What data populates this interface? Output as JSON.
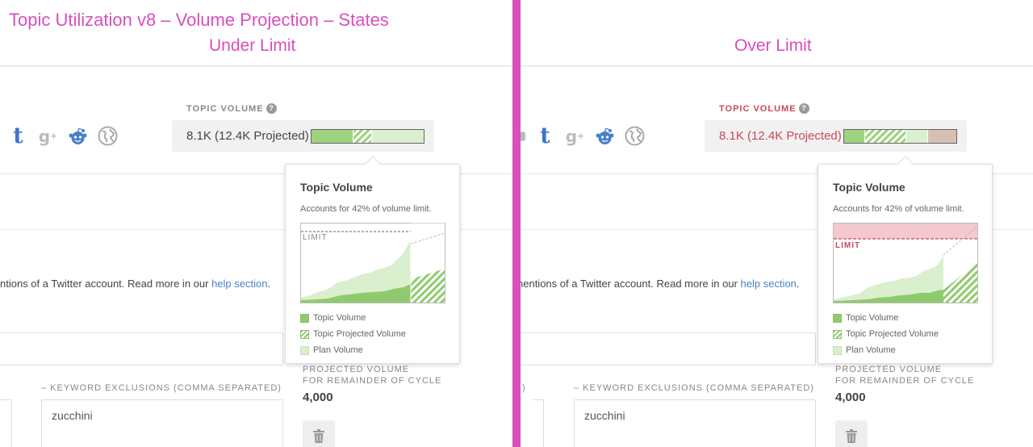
{
  "header": {
    "title": "Topic Utilization v8 – Volume Projection – States"
  },
  "states": {
    "under": {
      "label": "Under Limit",
      "topic_volume_label": "TOPIC VOLUME",
      "topic_volume_value": "8.1K (12.4K Projected)",
      "usage_bar": {
        "volume": 0.37,
        "projected": 0.16,
        "plan": 0.47,
        "over": 0
      },
      "popover": {
        "title": "Topic Volume",
        "subtitle": "Accounts for 42% of volume limit.",
        "limit_label": "LIMIT",
        "legend": [
          "Topic Volume",
          "Topic Projected Volume",
          "Plan Volume"
        ]
      }
    },
    "over": {
      "label": "Over Limit",
      "topic_volume_label": "TOPIC VOLUME",
      "topic_volume_value": "8.1K (12.4K Projected)",
      "usage_bar": {
        "volume": 0.18,
        "projected": 0.37,
        "plan": 0.19,
        "over": 0.26
      },
      "popover": {
        "title": "Topic Volume",
        "subtitle": "Accounts for 42% of volume limit.",
        "limit_label": "LIMIT",
        "legend": [
          "Topic Volume",
          "Topic Projected Volume",
          "Plan Volume"
        ]
      }
    }
  },
  "content": {
    "help_text_left": "ntions of a Twitter account. Read more in our ",
    "help_text_right": "nentions of a Twitter account. Read more in our ",
    "help_link": "help section",
    "period": ".",
    "keyword_exclusions_label": "– KEYWORD EXCLUSIONS (COMMA SEPARATED)",
    "keyword_exclusions_value": "zucchini",
    "stub_label_right": ")",
    "projected_volume_label_1": "PROJECTED VOLUME",
    "projected_volume_label_2": "FOR REMAINDER OF CYCLE",
    "projected_volume_value": "4,000"
  },
  "colors": {
    "accent": "#d94fbd",
    "volume_green": "#9fd27f",
    "plan_green": "#d9efce",
    "over_red": "#c9475e",
    "link": "#4a80c8"
  },
  "icons": [
    "tumblr-icon",
    "google-plus-icon",
    "reddit-icon",
    "globe-icon",
    "youtube-icon",
    "help-icon",
    "trash-icon"
  ]
}
